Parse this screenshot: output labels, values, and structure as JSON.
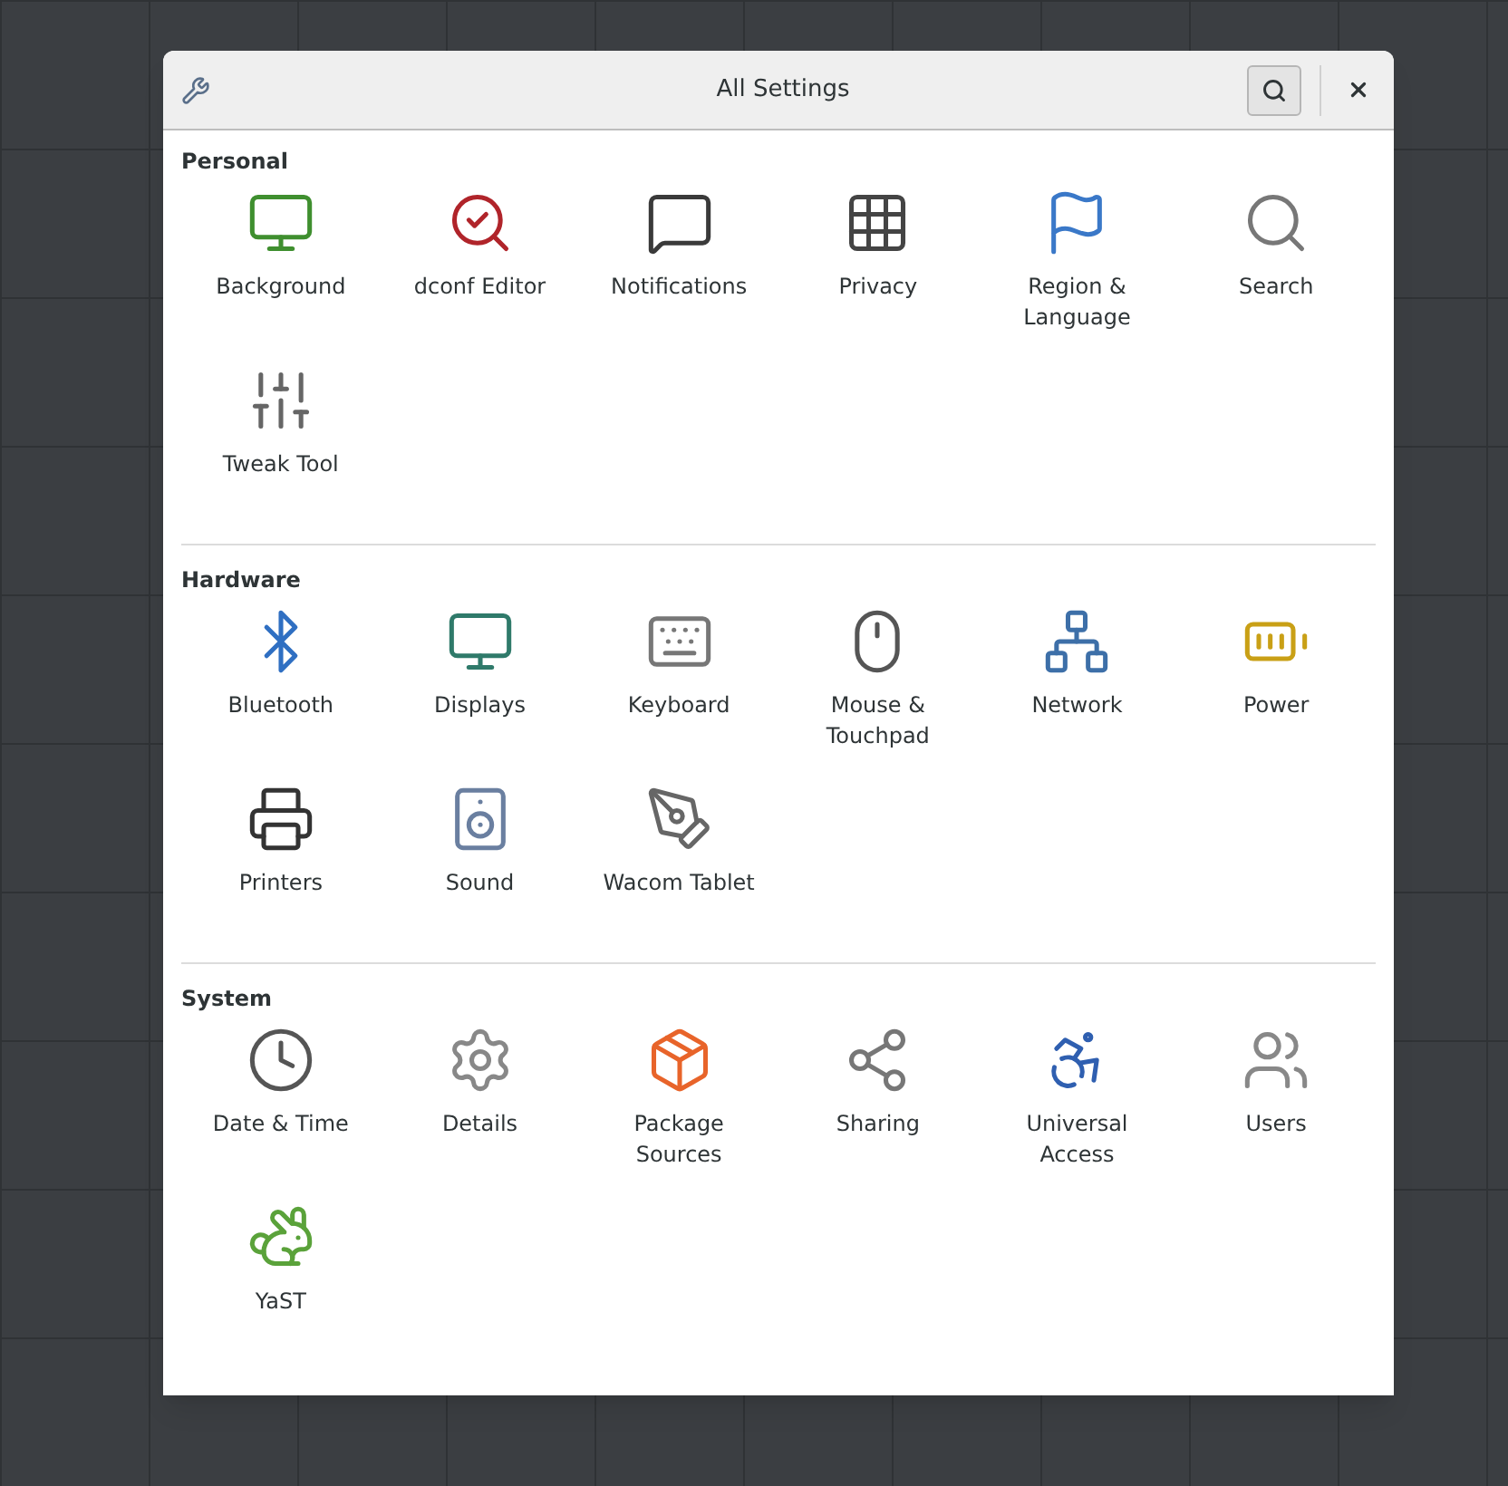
{
  "window": {
    "title": "All Settings"
  },
  "sections": [
    {
      "title": "Personal",
      "items": [
        {
          "label": "Background"
        },
        {
          "label": "dconf Editor"
        },
        {
          "label": "Notifications"
        },
        {
          "label": "Privacy"
        },
        {
          "label": "Region &\nLanguage"
        },
        {
          "label": "Search"
        },
        {
          "label": "Tweak Tool"
        }
      ]
    },
    {
      "title": "Hardware",
      "items": [
        {
          "label": "Bluetooth"
        },
        {
          "label": "Displays"
        },
        {
          "label": "Keyboard"
        },
        {
          "label": "Mouse &\nTouchpad"
        },
        {
          "label": "Network"
        },
        {
          "label": "Power"
        },
        {
          "label": "Printers"
        },
        {
          "label": "Sound"
        },
        {
          "label": "Wacom Tablet"
        }
      ]
    },
    {
      "title": "System",
      "items": [
        {
          "label": "Date & Time"
        },
        {
          "label": "Details"
        },
        {
          "label": "Package\nSources"
        },
        {
          "label": "Sharing"
        },
        {
          "label": "Universal\nAccess"
        },
        {
          "label": "Users"
        },
        {
          "label": "YaST"
        }
      ]
    }
  ]
}
